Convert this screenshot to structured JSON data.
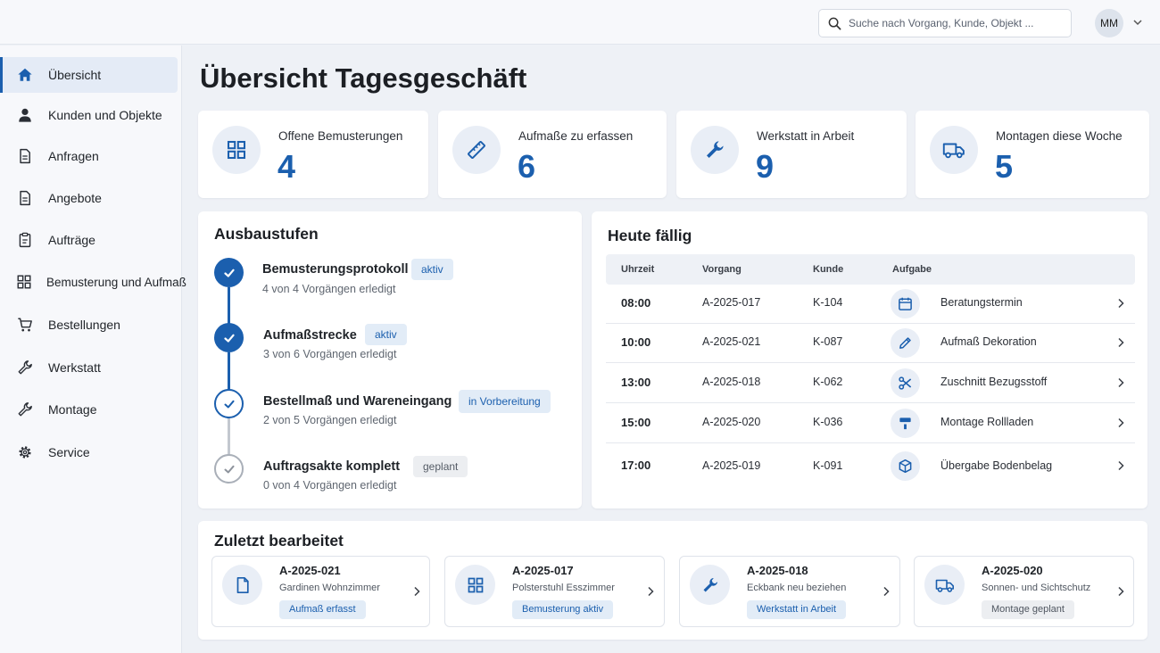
{
  "search": {
    "placeholder": "Suche nach Vorgang, Kunde, Objekt ..."
  },
  "user": {
    "initials": "MM"
  },
  "sidebar": {
    "items": [
      {
        "label": "Übersicht",
        "icon": "home-icon",
        "active": true
      },
      {
        "label": "Kunden und Objekte",
        "icon": "person-icon"
      },
      {
        "label": "Anfragen",
        "icon": "document-icon"
      },
      {
        "label": "Angebote",
        "icon": "document-icon"
      },
      {
        "label": "Aufträge",
        "icon": "clipboard-icon"
      },
      {
        "label": "Bemusterung und Aufmaß",
        "icon": "grid-icon"
      },
      {
        "label": "Bestellungen",
        "icon": "cart-icon"
      },
      {
        "label": "Werkstatt",
        "icon": "wrench-icon"
      },
      {
        "label": "Montage",
        "icon": "wrench-icon"
      },
      {
        "label": "Service",
        "icon": "gear-icon"
      }
    ]
  },
  "page": {
    "title": "Übersicht Tagesgeschäft"
  },
  "stats": [
    {
      "label": "Offene Bemusterungen",
      "value": "4",
      "icon": "grid-icon"
    },
    {
      "label": "Aufmaße zu erfassen",
      "value": "6",
      "icon": "ruler-icon"
    },
    {
      "label": "Werkstatt in Arbeit",
      "value": "9",
      "icon": "wrench-icon"
    },
    {
      "label": "Montagen diese Woche",
      "value": "5",
      "icon": "truck-icon"
    }
  ],
  "stages": {
    "title": "Ausbaustufen",
    "items": [
      {
        "name": "Bemusterungsprotokoll",
        "sub": "4 von 4 Vorgängen erledigt",
        "badge": "aktiv",
        "state": "done"
      },
      {
        "name": "Aufmaßstrecke",
        "sub": "3 von 6 Vorgängen erledigt",
        "badge": "aktiv",
        "state": "done"
      },
      {
        "name": "Bestellmaß und Wareneingang",
        "sub": "2 von 5 Vorgängen erledigt",
        "badge": "in Vorbereitung",
        "state": "progress"
      },
      {
        "name": "Auftragsakte komplett",
        "sub": "0 von 4 Vorgängen erledigt",
        "badge": "geplant",
        "state": "planned"
      }
    ]
  },
  "due": {
    "title": "Heute fällig",
    "columns": [
      "Uhrzeit",
      "Vorgang",
      "Kunde",
      "Aufgabe"
    ],
    "rows": [
      {
        "time": "08:00",
        "id": "A-2025-017",
        "customer": "K-104",
        "task": "Beratungstermin",
        "icon": "calendar-icon"
      },
      {
        "time": "10:00",
        "id": "A-2025-021",
        "customer": "K-087",
        "task": "Aufmaß Dekoration",
        "icon": "pencil-icon"
      },
      {
        "time": "13:00",
        "id": "A-2025-018",
        "customer": "K-062",
        "task": "Zuschnitt Bezugsstoff",
        "icon": "scissors-icon"
      },
      {
        "time": "15:00",
        "id": "A-2025-020",
        "customer": "K-036",
        "task": "Montage Rollladen",
        "icon": "paint-roller-icon"
      },
      {
        "time": "17:00",
        "id": "A-2025-019",
        "customer": "K-091",
        "task": "Übergabe Bodenbelag",
        "icon": "box-icon"
      }
    ]
  },
  "recent": {
    "title": "Zuletzt bearbeitet",
    "items": [
      {
        "id": "A-2025-021",
        "desc": "Gardinen Wohnzimmer",
        "badge": "Aufmaß erfasst",
        "tone": "blue",
        "icon": "document-icon"
      },
      {
        "id": "A-2025-017",
        "desc": "Polsterstuhl Esszimmer",
        "badge": "Bemusterung aktiv",
        "tone": "blue",
        "icon": "grid-icon"
      },
      {
        "id": "A-2025-018",
        "desc": "Eckbank neu beziehen",
        "badge": "Werkstatt in Arbeit",
        "tone": "blue",
        "icon": "wrench-icon"
      },
      {
        "id": "A-2025-020",
        "desc": "Sonnen- und Sichtschutz",
        "badge": "Montage geplant",
        "tone": "grey",
        "icon": "truck-icon"
      }
    ]
  },
  "colors": {
    "accent": "#1b5fae",
    "background": "#eef1f6",
    "badge_blue_bg": "#e2ecf7",
    "badge_grey_bg": "#eceef1"
  }
}
